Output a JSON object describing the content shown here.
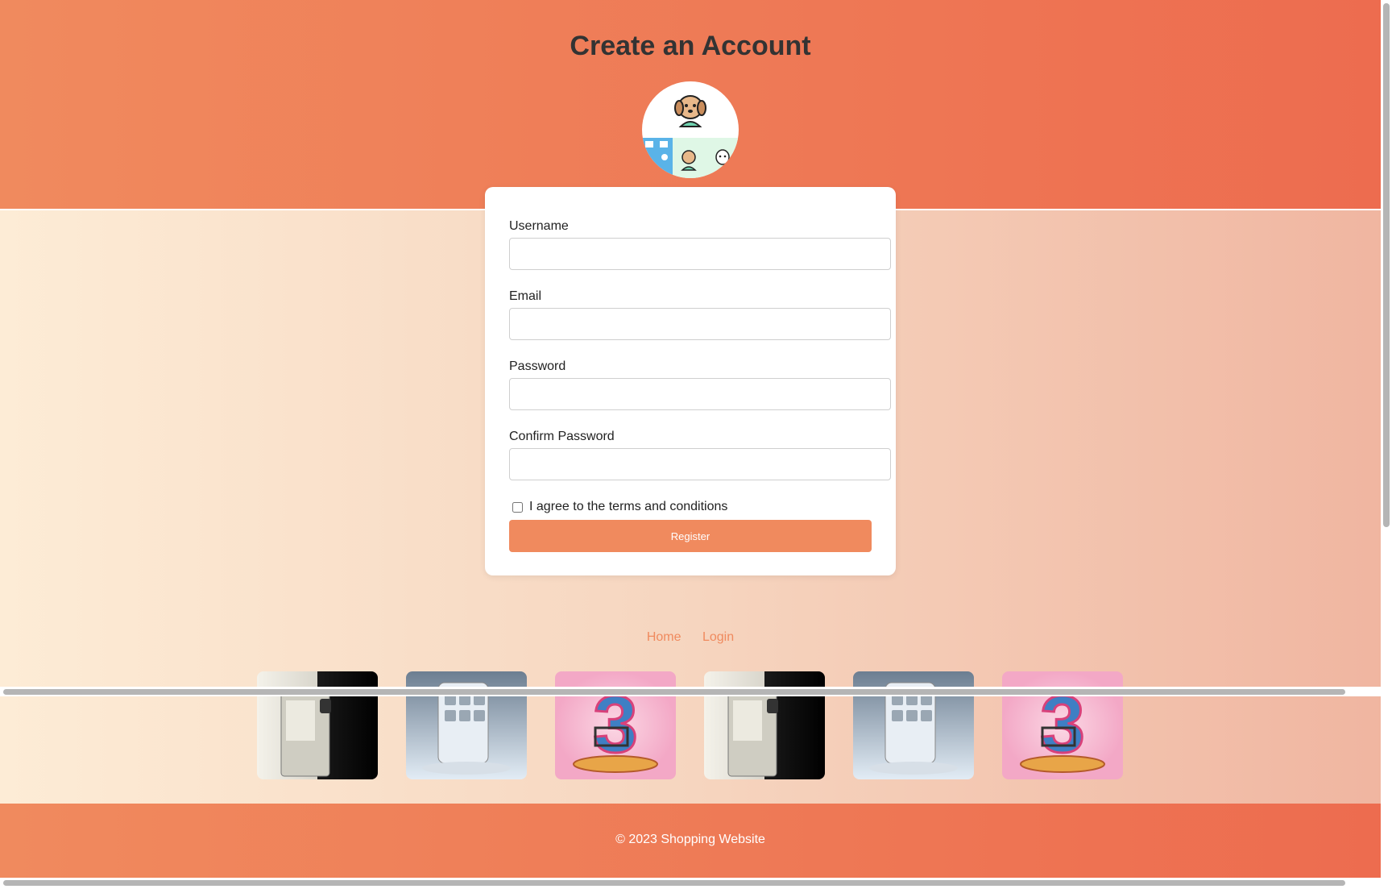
{
  "header": {
    "title": "Create an Account"
  },
  "avatar": {
    "icon": "puppy-mascot-icon"
  },
  "form": {
    "username_label": "Username",
    "username_value": "",
    "email_label": "Email",
    "email_value": "",
    "password_label": "Password",
    "password_value": "",
    "confirm_label": "Confirm Password",
    "confirm_value": "",
    "agree_label": "I agree to the terms and conditions",
    "agree_checked": false,
    "register_label": "Register"
  },
  "footer_nav": {
    "links": [
      "Home",
      "Login"
    ]
  },
  "gallery": {
    "items": [
      {
        "icon": "wall-device-image"
      },
      {
        "icon": "smartphone-app-image"
      },
      {
        "icon": "shopping-cart-3-image"
      },
      {
        "icon": "wall-device-image"
      },
      {
        "icon": "smartphone-app-image"
      },
      {
        "icon": "shopping-cart-3-image"
      }
    ]
  },
  "footer": {
    "copyright": "© 2023 Shopping Website"
  },
  "colors": {
    "accent": "#f08a5e",
    "header_end": "#ed6c4f",
    "title_text": "#333333"
  }
}
